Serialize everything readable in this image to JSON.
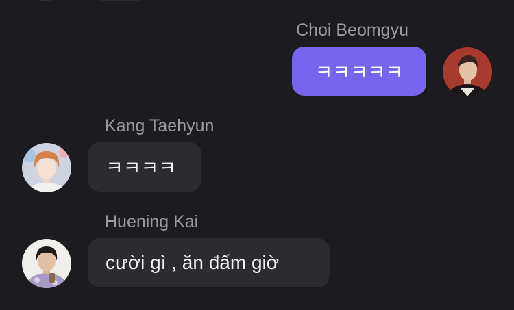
{
  "colors": {
    "background": "#1c1b1f",
    "outgoing_bubble": "#7765ef",
    "incoming_bubble": "#2c2b30",
    "sender_name": "#9c9aa1",
    "message_text": "#f2f2f4"
  },
  "messages": [
    {
      "direction": "outgoing",
      "sender": "Choi Beomgyu",
      "text": "ㅋㅋㅋㅋㅋ",
      "avatar_icon": "avatar-photo"
    },
    {
      "direction": "incoming",
      "sender": "Kang Taehyun",
      "text": "ㅋㅋㅋㅋ",
      "avatar_icon": "avatar-photo"
    },
    {
      "direction": "incoming",
      "sender": "Huening Kai",
      "text": "cười gì , ăn đấm giờ",
      "avatar_icon": "avatar-photo"
    }
  ]
}
